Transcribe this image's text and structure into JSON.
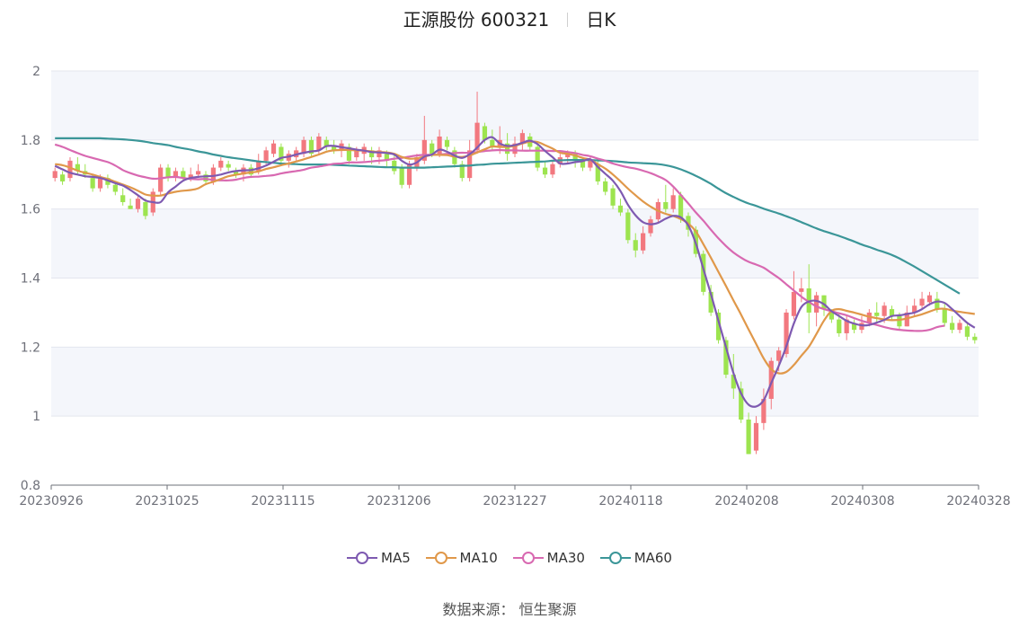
{
  "title": {
    "name": "正源股份 600321",
    "period": "日K"
  },
  "source_text": "数据来源：  恒生聚源",
  "colors": {
    "up": "#f2787f",
    "down": "#9de44f",
    "ma5": "#7e5ab1",
    "ma10": "#e0984a",
    "ma30": "#d869b1",
    "ma60": "#3b9698",
    "band": "#f4f6fb",
    "grid": "#e3e6ee",
    "axis": "#6e7079"
  },
  "chart_data": {
    "type": "candlestick",
    "ylim": [
      0.8,
      2.0
    ],
    "y_ticks": [
      "0.8",
      "1",
      "1.2",
      "1.4",
      "1.6",
      "1.8",
      "2"
    ],
    "x_ticks": [
      "20230926",
      "20231025",
      "20231115",
      "20231206",
      "20231227",
      "20240118",
      "20240208",
      "20240308",
      "20240328"
    ],
    "grid": true,
    "legend_position": "bottom-center",
    "series": [
      {
        "name": "MA5",
        "color": "#7e5ab1"
      },
      {
        "name": "MA10",
        "color": "#e0984a"
      },
      {
        "name": "MA30",
        "color": "#d869b1"
      },
      {
        "name": "MA60",
        "color": "#3b9698"
      }
    ],
    "candles": [
      [
        1.69,
        1.71,
        1.72,
        1.68
      ],
      [
        1.7,
        1.68,
        1.71,
        1.67
      ],
      [
        1.69,
        1.74,
        1.75,
        1.68
      ],
      [
        1.73,
        1.71,
        1.75,
        1.7
      ],
      [
        1.71,
        1.7,
        1.73,
        1.69
      ],
      [
        1.69,
        1.66,
        1.7,
        1.65
      ],
      [
        1.66,
        1.69,
        1.7,
        1.65
      ],
      [
        1.69,
        1.67,
        1.7,
        1.66
      ],
      [
        1.67,
        1.65,
        1.68,
        1.64
      ],
      [
        1.64,
        1.62,
        1.66,
        1.61
      ],
      [
        1.61,
        1.6,
        1.63,
        1.6
      ],
      [
        1.6,
        1.63,
        1.64,
        1.59
      ],
      [
        1.62,
        1.58,
        1.63,
        1.57
      ],
      [
        1.59,
        1.65,
        1.66,
        1.58
      ],
      [
        1.65,
        1.72,
        1.73,
        1.64
      ],
      [
        1.72,
        1.69,
        1.73,
        1.68
      ],
      [
        1.69,
        1.71,
        1.72,
        1.68
      ],
      [
        1.71,
        1.69,
        1.72,
        1.68
      ],
      [
        1.69,
        1.7,
        1.72,
        1.68
      ],
      [
        1.7,
        1.71,
        1.73,
        1.69
      ],
      [
        1.7,
        1.68,
        1.71,
        1.67
      ],
      [
        1.68,
        1.72,
        1.73,
        1.67
      ],
      [
        1.72,
        1.74,
        1.75,
        1.71
      ],
      [
        1.73,
        1.72,
        1.74,
        1.71
      ],
      [
        1.71,
        1.7,
        1.72,
        1.69
      ],
      [
        1.7,
        1.72,
        1.73,
        1.68
      ],
      [
        1.72,
        1.7,
        1.73,
        1.69
      ],
      [
        1.71,
        1.74,
        1.76,
        1.7
      ],
      [
        1.74,
        1.77,
        1.78,
        1.73
      ],
      [
        1.76,
        1.79,
        1.8,
        1.75
      ],
      [
        1.78,
        1.74,
        1.79,
        1.73
      ],
      [
        1.74,
        1.76,
        1.77,
        1.72
      ],
      [
        1.75,
        1.77,
        1.78,
        1.74
      ],
      [
        1.76,
        1.8,
        1.81,
        1.75
      ],
      [
        1.8,
        1.76,
        1.81,
        1.75
      ],
      [
        1.77,
        1.81,
        1.82,
        1.76
      ],
      [
        1.8,
        1.78,
        1.81,
        1.77
      ],
      [
        1.78,
        1.77,
        1.8,
        1.76
      ],
      [
        1.77,
        1.79,
        1.8,
        1.75
      ],
      [
        1.78,
        1.74,
        1.79,
        1.73
      ],
      [
        1.75,
        1.77,
        1.78,
        1.74
      ],
      [
        1.76,
        1.78,
        1.79,
        1.74
      ],
      [
        1.77,
        1.75,
        1.78,
        1.73
      ],
      [
        1.75,
        1.77,
        1.78,
        1.73
      ],
      [
        1.76,
        1.74,
        1.77,
        1.72
      ],
      [
        1.74,
        1.71,
        1.76,
        1.7
      ],
      [
        1.72,
        1.67,
        1.73,
        1.66
      ],
      [
        1.67,
        1.73,
        1.74,
        1.66
      ],
      [
        1.72,
        1.75,
        1.76,
        1.71
      ],
      [
        1.74,
        1.8,
        1.87,
        1.73
      ],
      [
        1.79,
        1.76,
        1.8,
        1.75
      ],
      [
        1.76,
        1.81,
        1.83,
        1.75
      ],
      [
        1.8,
        1.78,
        1.81,
        1.77
      ],
      [
        1.77,
        1.73,
        1.78,
        1.72
      ],
      [
        1.73,
        1.69,
        1.74,
        1.68
      ],
      [
        1.69,
        1.77,
        1.8,
        1.68
      ],
      [
        1.77,
        1.85,
        1.94,
        1.76
      ],
      [
        1.84,
        1.8,
        1.85,
        1.79
      ],
      [
        1.8,
        1.78,
        1.83,
        1.77
      ],
      [
        1.78,
        1.8,
        1.84,
        1.76
      ],
      [
        1.79,
        1.76,
        1.82,
        1.74
      ],
      [
        1.76,
        1.79,
        1.81,
        1.75
      ],
      [
        1.79,
        1.82,
        1.83,
        1.77
      ],
      [
        1.81,
        1.78,
        1.82,
        1.77
      ],
      [
        1.78,
        1.72,
        1.79,
        1.71
      ],
      [
        1.72,
        1.7,
        1.74,
        1.69
      ],
      [
        1.7,
        1.73,
        1.74,
        1.69
      ],
      [
        1.73,
        1.75,
        1.76,
        1.72
      ],
      [
        1.75,
        1.76,
        1.77,
        1.73
      ],
      [
        1.76,
        1.74,
        1.77,
        1.72
      ],
      [
        1.74,
        1.72,
        1.75,
        1.71
      ],
      [
        1.72,
        1.74,
        1.75,
        1.71
      ],
      [
        1.73,
        1.68,
        1.74,
        1.67
      ],
      [
        1.68,
        1.65,
        1.69,
        1.64
      ],
      [
        1.66,
        1.61,
        1.67,
        1.6
      ],
      [
        1.61,
        1.59,
        1.63,
        1.58
      ],
      [
        1.59,
        1.51,
        1.6,
        1.5
      ],
      [
        1.51,
        1.48,
        1.53,
        1.46
      ],
      [
        1.48,
        1.53,
        1.55,
        1.47
      ],
      [
        1.53,
        1.57,
        1.58,
        1.52
      ],
      [
        1.57,
        1.62,
        1.63,
        1.56
      ],
      [
        1.62,
        1.6,
        1.67,
        1.59
      ],
      [
        1.6,
        1.64,
        1.66,
        1.59
      ],
      [
        1.64,
        1.57,
        1.65,
        1.56
      ],
      [
        1.58,
        1.54,
        1.59,
        1.52
      ],
      [
        1.54,
        1.47,
        1.55,
        1.46
      ],
      [
        1.47,
        1.36,
        1.48,
        1.35
      ],
      [
        1.36,
        1.3,
        1.38,
        1.29
      ],
      [
        1.3,
        1.22,
        1.31,
        1.21
      ],
      [
        1.22,
        1.12,
        1.23,
        1.11
      ],
      [
        1.12,
        1.08,
        1.18,
        1.05
      ],
      [
        1.08,
        0.99,
        1.1,
        0.98
      ],
      [
        0.99,
        0.89,
        1.01,
        0.89
      ],
      [
        0.9,
        0.98,
        1.0,
        0.89
      ],
      [
        0.98,
        1.05,
        1.08,
        0.96
      ],
      [
        1.05,
        1.16,
        1.17,
        1.02
      ],
      [
        1.16,
        1.19,
        1.2,
        1.13
      ],
      [
        1.18,
        1.3,
        1.31,
        1.17
      ],
      [
        1.29,
        1.36,
        1.42,
        1.28
      ],
      [
        1.36,
        1.37,
        1.4,
        1.33
      ],
      [
        1.37,
        1.3,
        1.44,
        1.24
      ],
      [
        1.3,
        1.35,
        1.36,
        1.26
      ],
      [
        1.35,
        1.31,
        1.35,
        1.29
      ],
      [
        1.3,
        1.28,
        1.31,
        1.27
      ],
      [
        1.28,
        1.24,
        1.3,
        1.23
      ],
      [
        1.24,
        1.28,
        1.29,
        1.22
      ],
      [
        1.27,
        1.25,
        1.28,
        1.24
      ],
      [
        1.25,
        1.27,
        1.29,
        1.24
      ],
      [
        1.27,
        1.3,
        1.31,
        1.26
      ],
      [
        1.3,
        1.29,
        1.33,
        1.27
      ],
      [
        1.29,
        1.32,
        1.33,
        1.27
      ],
      [
        1.31,
        1.29,
        1.32,
        1.28
      ],
      [
        1.29,
        1.26,
        1.3,
        1.25
      ],
      [
        1.26,
        1.3,
        1.32,
        1.26
      ],
      [
        1.3,
        1.32,
        1.34,
        1.29
      ],
      [
        1.32,
        1.34,
        1.36,
        1.31
      ],
      [
        1.33,
        1.35,
        1.36,
        1.32
      ],
      [
        1.34,
        1.31,
        1.36,
        1.3
      ],
      [
        1.31,
        1.27,
        1.33,
        1.26
      ],
      [
        1.27,
        1.25,
        1.29,
        1.24
      ],
      [
        1.25,
        1.27,
        1.28,
        1.24
      ],
      [
        1.26,
        1.23,
        1.27,
        1.22
      ],
      [
        1.23,
        1.22,
        1.24,
        1.21
      ]
    ],
    "ma5": [
      1.725,
      1.715,
      1.705,
      1.7,
      1.695,
      1.693,
      1.69,
      1.683,
      1.675,
      1.668,
      1.655,
      1.64,
      1.625,
      1.62,
      1.62,
      1.648,
      1.665,
      1.682,
      1.69,
      1.693,
      1.695,
      1.696,
      1.7,
      1.706,
      1.71,
      1.712,
      1.713,
      1.718,
      1.726,
      1.737,
      1.748,
      1.752,
      1.758,
      1.763,
      1.767,
      1.77,
      1.782,
      1.783,
      1.779,
      1.776,
      1.772,
      1.769,
      1.765,
      1.764,
      1.762,
      1.758,
      1.74,
      1.729,
      1.735,
      1.752,
      1.758,
      1.772,
      1.766,
      1.755,
      1.748,
      1.759,
      1.778,
      1.8,
      1.808,
      1.79,
      1.783,
      1.785,
      1.792,
      1.798,
      1.788,
      1.768,
      1.75,
      1.732,
      1.732,
      1.736,
      1.739,
      1.744,
      1.722,
      1.702,
      1.682,
      1.652,
      1.612,
      1.582,
      1.562,
      1.556,
      1.56,
      1.572,
      1.58,
      1.576,
      1.552,
      1.5,
      1.426,
      1.354,
      1.276,
      1.2,
      1.124,
      1.066,
      1.033,
      1.028,
      1.046,
      1.096,
      1.146,
      1.202,
      1.268,
      1.316,
      1.332,
      1.334,
      1.324,
      1.304,
      1.29,
      1.276,
      1.268,
      1.263,
      1.264,
      1.271,
      1.279,
      1.29,
      1.292,
      1.296,
      1.3,
      1.31,
      1.324,
      1.332,
      1.328,
      1.31,
      1.29,
      1.27,
      1.256
    ],
    "ma10": [
      1.73,
      1.727,
      1.72,
      1.711,
      1.705,
      1.7,
      1.693,
      1.687,
      1.679,
      1.671,
      1.663,
      1.653,
      1.642,
      1.639,
      1.639,
      1.645,
      1.65,
      1.653,
      1.655,
      1.66,
      1.672,
      1.679,
      1.687,
      1.695,
      1.699,
      1.703,
      1.706,
      1.709,
      1.716,
      1.721,
      1.727,
      1.732,
      1.738,
      1.744,
      1.751,
      1.758,
      1.766,
      1.77,
      1.771,
      1.771,
      1.77,
      1.769,
      1.767,
      1.765,
      1.764,
      1.76,
      1.751,
      1.746,
      1.747,
      1.752,
      1.757,
      1.757,
      1.756,
      1.752,
      1.751,
      1.755,
      1.764,
      1.773,
      1.781,
      1.78,
      1.78,
      1.783,
      1.79,
      1.795,
      1.794,
      1.785,
      1.775,
      1.763,
      1.76,
      1.755,
      1.748,
      1.743,
      1.73,
      1.717,
      1.7,
      1.68,
      1.659,
      1.64,
      1.622,
      1.607,
      1.595,
      1.586,
      1.58,
      1.571,
      1.558,
      1.535,
      1.498,
      1.459,
      1.418,
      1.377,
      1.335,
      1.294,
      1.251,
      1.209,
      1.167,
      1.136,
      1.124,
      1.128,
      1.148,
      1.175,
      1.201,
      1.238,
      1.277,
      1.305,
      1.31,
      1.305,
      1.3,
      1.294,
      1.288,
      1.284,
      1.28,
      1.278,
      1.279,
      1.283,
      1.289,
      1.295,
      1.303,
      1.31,
      1.311,
      1.306,
      1.302,
      1.299,
      1.296
    ],
    "ma30": [
      1.787,
      1.78,
      1.771,
      1.762,
      1.754,
      1.748,
      1.742,
      1.736,
      1.726,
      1.713,
      1.704,
      1.697,
      1.692,
      1.688,
      1.689,
      1.692,
      1.693,
      1.69,
      1.687,
      1.686,
      1.687,
      1.684,
      1.683,
      1.683,
      1.685,
      1.69,
      1.693,
      1.694,
      1.696,
      1.698,
      1.703,
      1.707,
      1.71,
      1.714,
      1.72,
      1.723,
      1.727,
      1.731,
      1.732,
      1.735,
      1.735,
      1.736,
      1.738,
      1.74,
      1.742,
      1.746,
      1.748,
      1.752,
      1.755,
      1.757,
      1.757,
      1.758,
      1.76,
      1.762,
      1.763,
      1.763,
      1.765,
      1.768,
      1.77,
      1.771,
      1.77,
      1.77,
      1.769,
      1.769,
      1.769,
      1.769,
      1.768,
      1.768,
      1.765,
      1.762,
      1.757,
      1.753,
      1.746,
      1.74,
      1.732,
      1.726,
      1.721,
      1.717,
      1.711,
      1.704,
      1.695,
      1.684,
      1.665,
      1.641,
      1.616,
      1.59,
      1.566,
      1.54,
      1.515,
      1.493,
      1.474,
      1.459,
      1.447,
      1.439,
      1.43,
      1.415,
      1.4,
      1.382,
      1.364,
      1.346,
      1.331,
      1.318,
      1.31,
      1.304,
      1.298,
      1.292,
      1.284,
      1.276,
      1.27,
      1.264,
      1.258,
      1.253,
      1.25,
      1.248,
      1.247,
      1.247,
      1.25,
      1.258,
      1.262
    ],
    "ma60": [
      1.805,
      1.805,
      1.805,
      1.805,
      1.805,
      1.805,
      1.805,
      1.804,
      1.803,
      1.802,
      1.8,
      1.798,
      1.795,
      1.791,
      1.788,
      1.785,
      1.78,
      1.776,
      1.772,
      1.767,
      1.763,
      1.758,
      1.754,
      1.75,
      1.747,
      1.744,
      1.741,
      1.738,
      1.736,
      1.734,
      1.732,
      1.731,
      1.73,
      1.729,
      1.729,
      1.729,
      1.729,
      1.728,
      1.727,
      1.726,
      1.725,
      1.724,
      1.723,
      1.722,
      1.721,
      1.721,
      1.72,
      1.72,
      1.72,
      1.72,
      1.721,
      1.722,
      1.723,
      1.724,
      1.725,
      1.726,
      1.728,
      1.729,
      1.731,
      1.732,
      1.733,
      1.734,
      1.735,
      1.736,
      1.737,
      1.738,
      1.74,
      1.741,
      1.742,
      1.742,
      1.742,
      1.742,
      1.741,
      1.74,
      1.739,
      1.737,
      1.735,
      1.734,
      1.733,
      1.732,
      1.73,
      1.727,
      1.722,
      1.715,
      1.706,
      1.696,
      1.685,
      1.673,
      1.659,
      1.646,
      1.635,
      1.625,
      1.616,
      1.609,
      1.601,
      1.594,
      1.587,
      1.579,
      1.571,
      1.562,
      1.553,
      1.544,
      1.536,
      1.529,
      1.522,
      1.514,
      1.506,
      1.497,
      1.49,
      1.482,
      1.475,
      1.467,
      1.457,
      1.445,
      1.433,
      1.42,
      1.407,
      1.394,
      1.381,
      1.368,
      1.355
    ]
  }
}
